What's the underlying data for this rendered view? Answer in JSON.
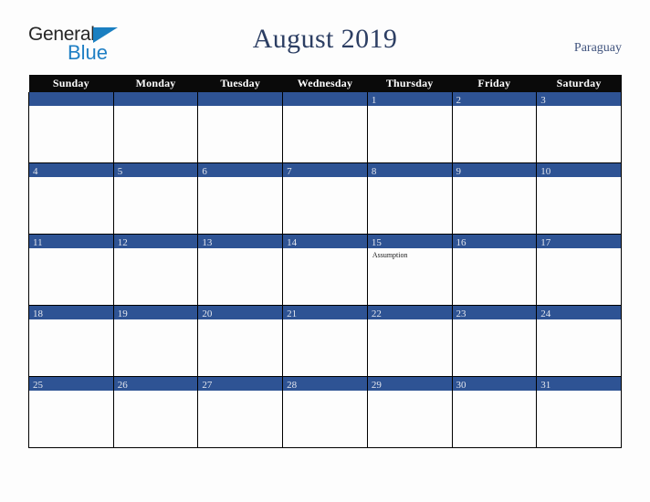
{
  "brand": {
    "name_part1": "General",
    "name_part2": "Blue",
    "triangle_icon": "triangle-right-icon",
    "accent_color": "#1f7fc4"
  },
  "header": {
    "title": "August 2019",
    "country": "Paraguay",
    "title_color": "#2c3e63"
  },
  "calendar": {
    "header_bg": "#0a0a0a",
    "daybar_bg": "#2e5394",
    "weekdays": [
      "Sunday",
      "Monday",
      "Tuesday",
      "Wednesday",
      "Thursday",
      "Friday",
      "Saturday"
    ],
    "weeks": [
      [
        {
          "day": "",
          "event": ""
        },
        {
          "day": "",
          "event": ""
        },
        {
          "day": "",
          "event": ""
        },
        {
          "day": "",
          "event": ""
        },
        {
          "day": "1",
          "event": ""
        },
        {
          "day": "2",
          "event": ""
        },
        {
          "day": "3",
          "event": ""
        }
      ],
      [
        {
          "day": "4",
          "event": ""
        },
        {
          "day": "5",
          "event": ""
        },
        {
          "day": "6",
          "event": ""
        },
        {
          "day": "7",
          "event": ""
        },
        {
          "day": "8",
          "event": ""
        },
        {
          "day": "9",
          "event": ""
        },
        {
          "day": "10",
          "event": ""
        }
      ],
      [
        {
          "day": "11",
          "event": ""
        },
        {
          "day": "12",
          "event": ""
        },
        {
          "day": "13",
          "event": ""
        },
        {
          "day": "14",
          "event": ""
        },
        {
          "day": "15",
          "event": "Assumption"
        },
        {
          "day": "16",
          "event": ""
        },
        {
          "day": "17",
          "event": ""
        }
      ],
      [
        {
          "day": "18",
          "event": ""
        },
        {
          "day": "19",
          "event": ""
        },
        {
          "day": "20",
          "event": ""
        },
        {
          "day": "21",
          "event": ""
        },
        {
          "day": "22",
          "event": ""
        },
        {
          "day": "23",
          "event": ""
        },
        {
          "day": "24",
          "event": ""
        }
      ],
      [
        {
          "day": "25",
          "event": ""
        },
        {
          "day": "26",
          "event": ""
        },
        {
          "day": "27",
          "event": ""
        },
        {
          "day": "28",
          "event": ""
        },
        {
          "day": "29",
          "event": ""
        },
        {
          "day": "30",
          "event": ""
        },
        {
          "day": "31",
          "event": ""
        }
      ]
    ]
  }
}
